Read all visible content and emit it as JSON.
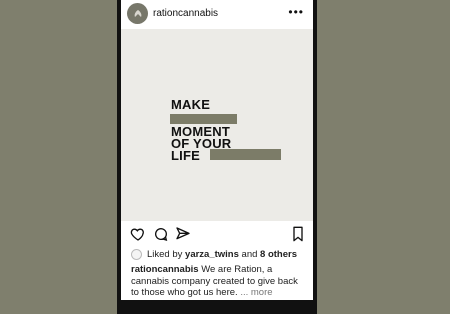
{
  "post": {
    "username": "rationcannabis",
    "more_icon": "ellipsis-icon",
    "lines": [
      "MAKE",
      "MOMENT",
      "OF YOUR",
      "LIFE"
    ],
    "bar_color": "#7c7c68",
    "background_color": "#ecebe7"
  },
  "actions": {
    "like_icon": "heart-icon",
    "comment_icon": "comment-icon",
    "share_icon": "send-icon",
    "save_icon": "bookmark-icon"
  },
  "likes": {
    "prefix": "Liked by",
    "user": "yarza_twins",
    "connector": "and",
    "others": "8 others"
  },
  "caption": {
    "user": "rationcannabis",
    "text": "We are Ration, a cannabis company created to give back to those who got us here.",
    "more": "... more"
  },
  "colors": {
    "page_background": "#7f7f6d",
    "accent": "#7c7c68"
  }
}
